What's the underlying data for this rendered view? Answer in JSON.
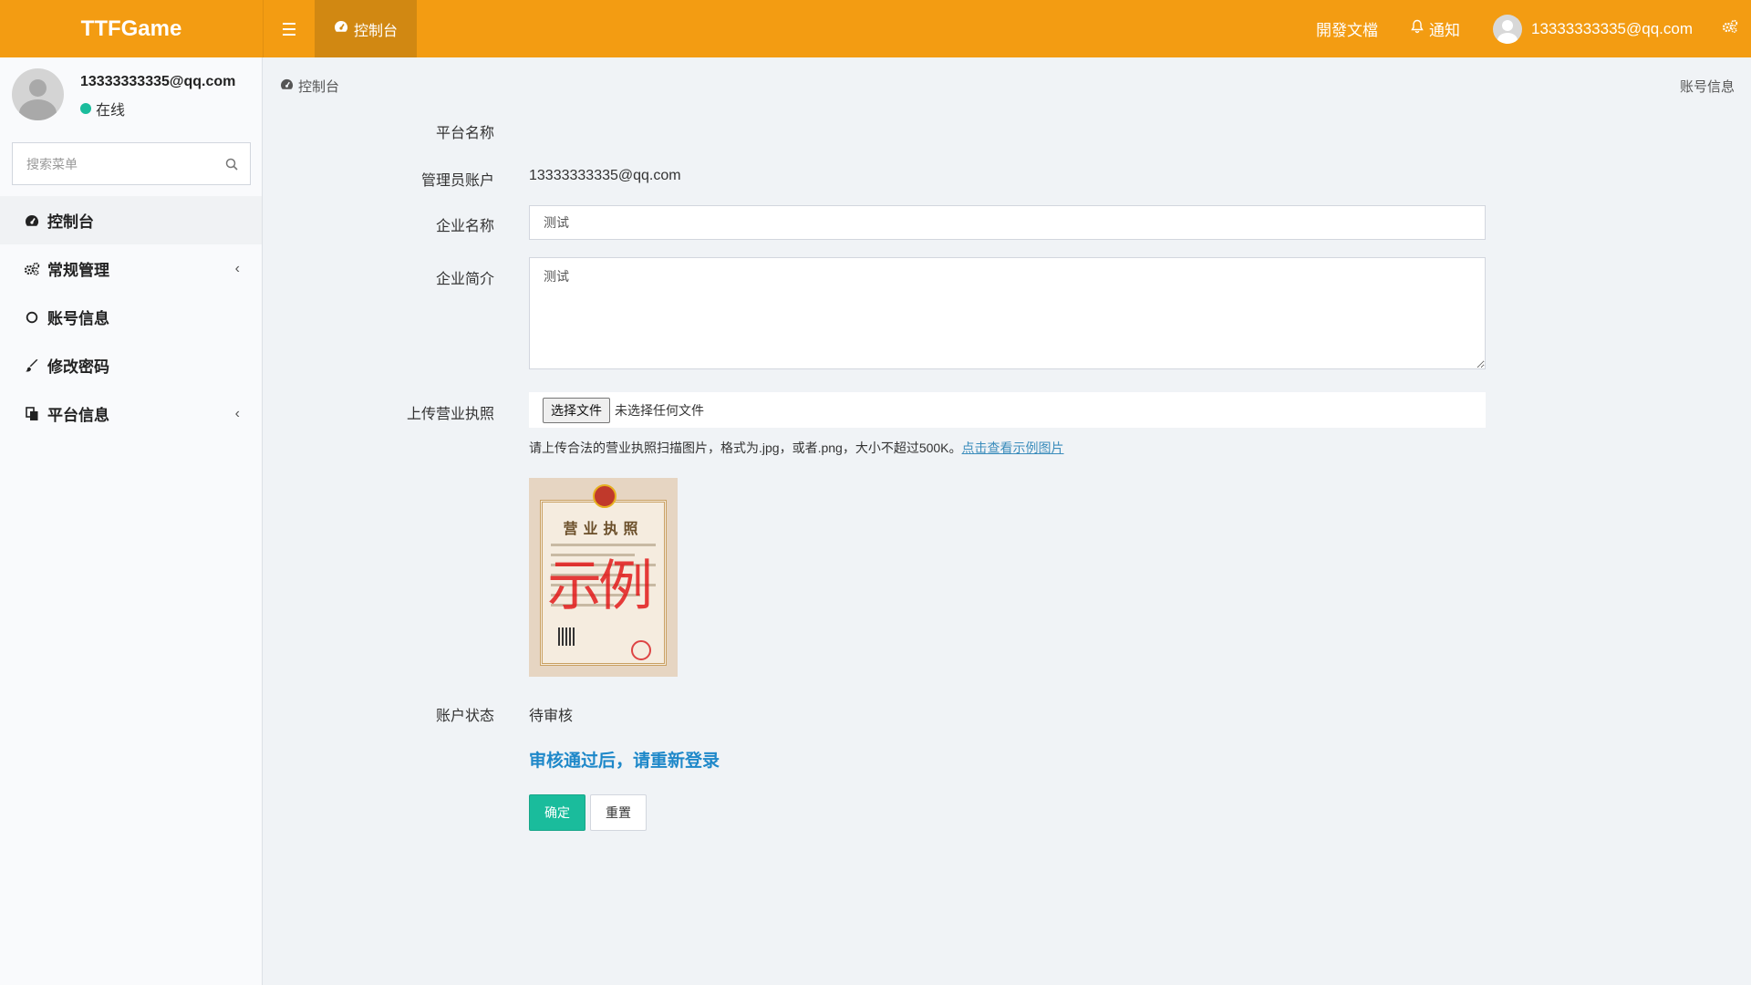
{
  "header": {
    "logo": "TTFGame",
    "tab_label": "控制台",
    "docs_label": "開發文檔",
    "notify_label": "通知",
    "user_email": "13333333335@qq.com"
  },
  "sidebar": {
    "user_email": "13333333335@qq.com",
    "status": "在线",
    "status_color": "#1abc9c",
    "search_placeholder": "搜索菜单",
    "items": [
      {
        "label": "控制台",
        "icon": "dashboard-icon",
        "active": true
      },
      {
        "label": "常规管理",
        "icon": "gears-icon",
        "expandable": true
      },
      {
        "label": "账号信息",
        "icon": "circle-icon"
      },
      {
        "label": "修改密码",
        "icon": "brush-icon"
      },
      {
        "label": "平台信息",
        "icon": "copy-icon",
        "expandable": true
      }
    ]
  },
  "breadcrumb": {
    "left": "控制台",
    "right": "账号信息"
  },
  "form": {
    "platform_name_label": "平台名称",
    "admin_account_label": "管理员账户",
    "admin_account_value": "13333333335@qq.com",
    "company_name_label": "企业名称",
    "company_name_value": "测试",
    "company_intro_label": "企业简介",
    "company_intro_value": "测试",
    "upload_label": "上传营业执照",
    "file_button": "选择文件",
    "file_status": "未选择任何文件",
    "hint_text": "请上传合法的营业执照扫描图片，格式为.jpg，或者.png，大小不超过500K。",
    "hint_link": "点击查看示例图片",
    "license_title": "营业执照",
    "license_watermark": "示例",
    "status_label": "账户状态",
    "status_value": "待审核",
    "notice": "审核通过后，请重新登录",
    "confirm_button": "确定",
    "reset_button": "重置"
  },
  "colors": {
    "header_bg": "#f39c12",
    "active_tab_bg": "#d18812",
    "confirm_bg": "#1abc9c",
    "notice": "#1e88c9"
  }
}
